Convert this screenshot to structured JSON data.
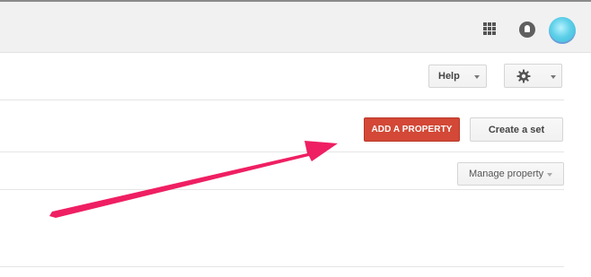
{
  "header": {
    "apps_icon": "apps-grid-icon",
    "notification_icon": "notifications-icon",
    "avatar": "user-avatar"
  },
  "toolbar": {
    "help_label": "Help",
    "settings_icon": "gear-icon"
  },
  "actions": {
    "add_property_label": "ADD A PROPERTY",
    "create_set_label": "Create a set"
  },
  "property": {
    "manage_label": "Manage property"
  },
  "colors": {
    "accent": "#d34836",
    "annotation_arrow": "#ef1f63"
  }
}
